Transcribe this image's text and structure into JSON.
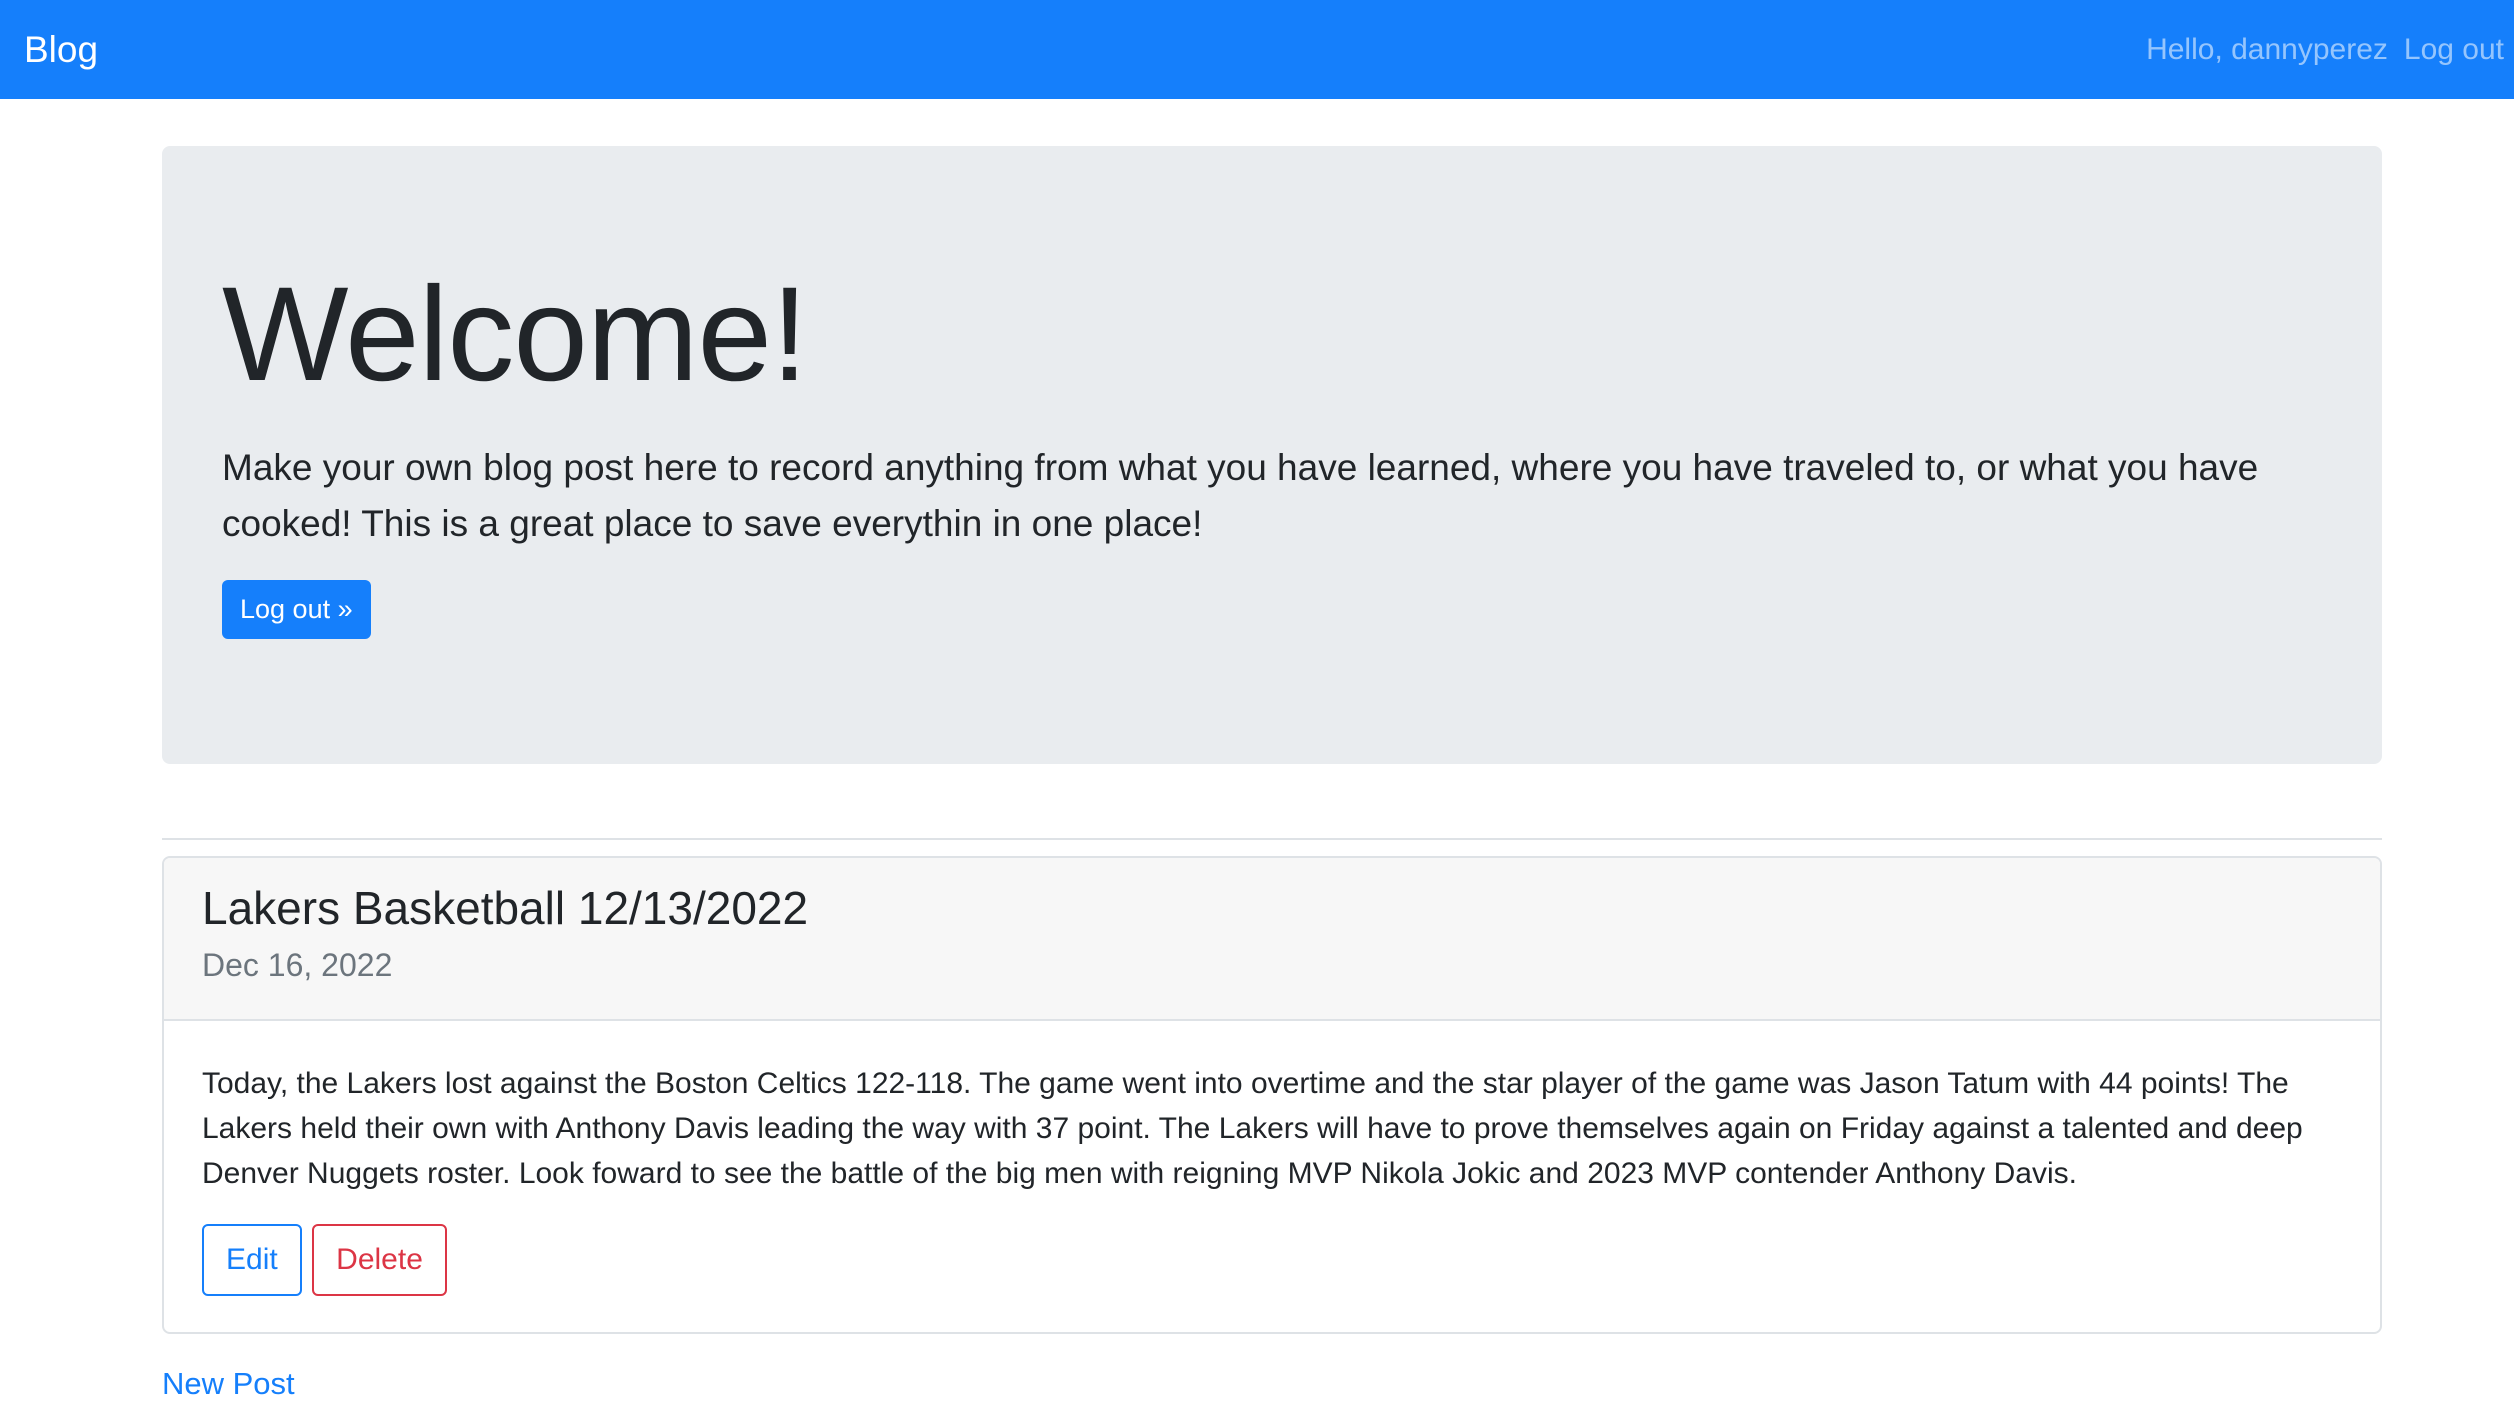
{
  "navbar": {
    "brand": "Blog",
    "greeting": "Hello, dannyperez",
    "logout_label": "Log out"
  },
  "jumbotron": {
    "title": "Welcome!",
    "lead": "Make your own blog post here to record anything from what you have learned, where you have traveled to, or what you have cooked! This is a great place to save everythin in one place!",
    "button_label": "Log out »"
  },
  "posts": [
    {
      "title": "Lakers Basketball 12/13/2022",
      "date": "Dec 16, 2022",
      "body": "Today, the Lakers lost against the Boston Celtics 122-118. The game went into overtime and the star player of the game was Jason Tatum with 44 points! The Lakers held their own with Anthony Davis leading the way with 37 point. The Lakers will have to prove themselves again on Friday against a talented and deep Denver Nuggets roster. Look foward to see the battle of the big men with reigning MVP Nikola Jokic and 2023 MVP contender Anthony Davis.",
      "edit_label": "Edit",
      "delete_label": "Delete"
    }
  ],
  "new_post_label": "New Post",
  "colors": {
    "primary": "#157ffb",
    "danger": "#dc3545",
    "jumbotron_bg": "#e9ecef",
    "muted": "#6c757d"
  }
}
